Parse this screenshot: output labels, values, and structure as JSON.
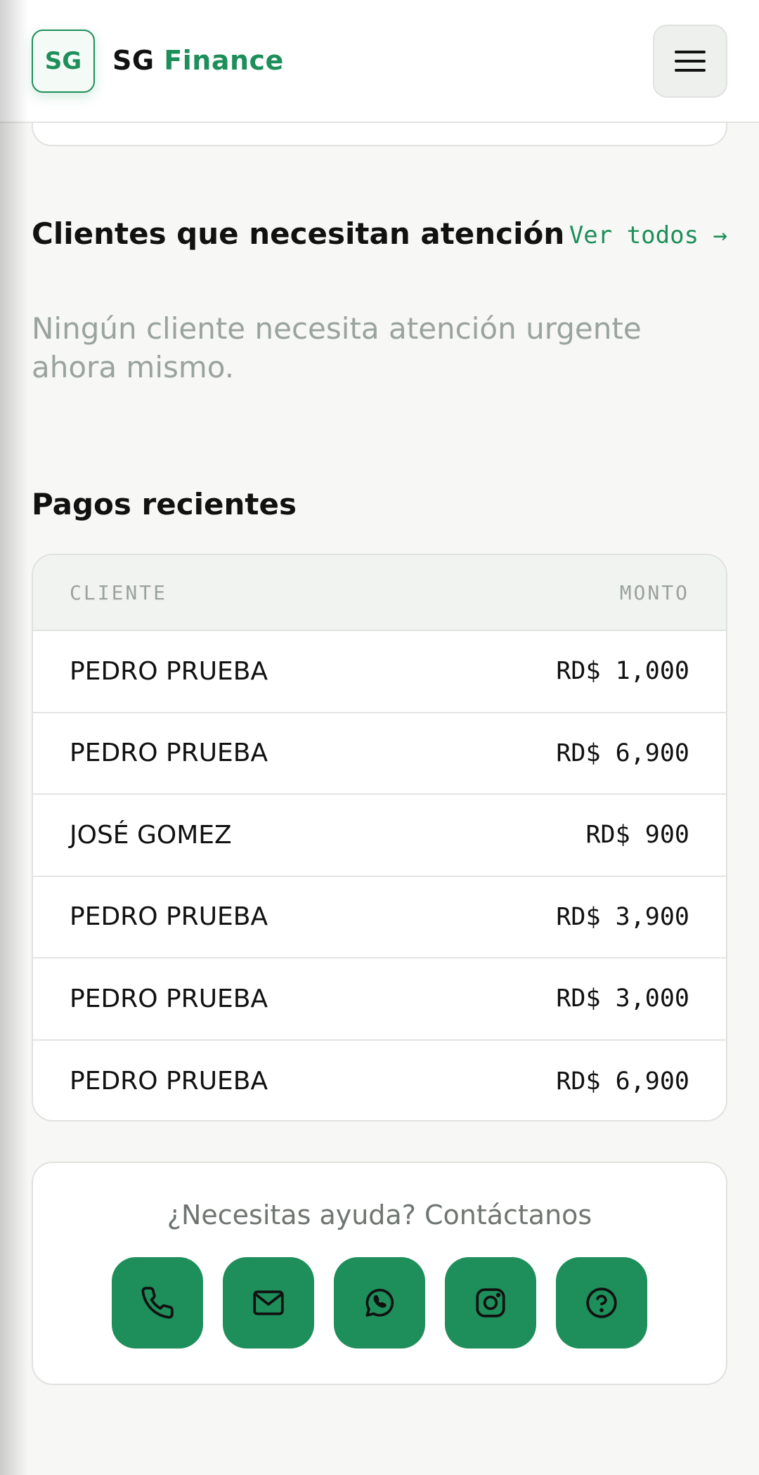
{
  "header": {
    "logo_initials": "SG",
    "brand_part1": "SG",
    "brand_part2": "Finance",
    "menu_icon": "hamburger-menu-icon"
  },
  "attention": {
    "title": "Clientes que necesitan atención",
    "see_all": "Ver todos →",
    "empty_message": "Ningún cliente necesita atención urgente ahora mismo."
  },
  "payments": {
    "title": "Pagos recientes",
    "columns": [
      "CLIENTE",
      "MONTO"
    ],
    "rows": [
      {
        "client": "PEDRO PRUEBA",
        "amount": "RD$ 1,000"
      },
      {
        "client": "PEDRO PRUEBA",
        "amount": "RD$ 6,900"
      },
      {
        "client": "JOSÉ GOMEZ",
        "amount": "RD$ 900"
      },
      {
        "client": "PEDRO PRUEBA",
        "amount": "RD$ 3,900"
      },
      {
        "client": "PEDRO PRUEBA",
        "amount": "RD$ 3,000"
      },
      {
        "client": "PEDRO PRUEBA",
        "amount": "RD$ 6,900"
      }
    ]
  },
  "help": {
    "text": "¿Necesitas ayuda? Contáctanos",
    "buttons": [
      "phone-icon",
      "mail-icon",
      "whatsapp-icon",
      "instagram-icon",
      "help-circle-icon"
    ]
  },
  "colors": {
    "accent": "#1e8f5a",
    "background": "#f7f7f5",
    "muted_text": "#9aa39c"
  }
}
